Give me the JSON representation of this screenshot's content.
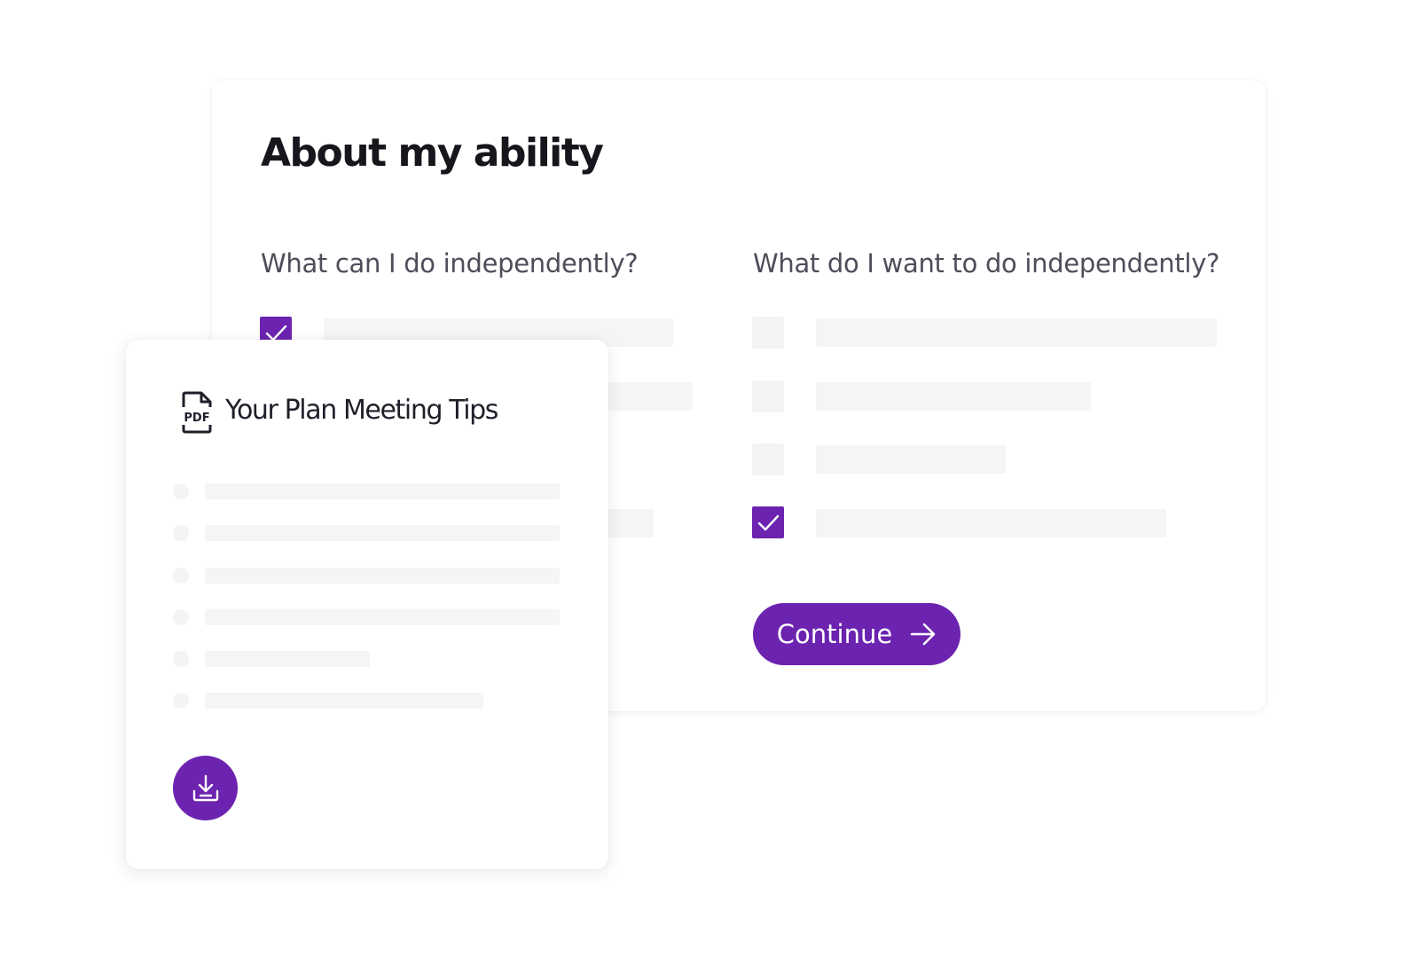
{
  "main_card": {
    "title": "About my ability",
    "left_column": {
      "question": "What can I do independently?",
      "checkboxes_checked": [
        true,
        false,
        false,
        false
      ]
    },
    "right_column": {
      "question": "What do I want to do independently?",
      "checkboxes_checked": [
        false,
        false,
        false,
        true
      ]
    },
    "continue_label": "Continue",
    "continue_icon": "arrow-right-icon"
  },
  "tips_card": {
    "title": "Your Plan Meeting Tips",
    "file_icon": "pdf-file-icon",
    "file_icon_label": "PDF",
    "download_icon": "download-icon"
  },
  "colors": {
    "accent": "#6c23b0",
    "placeholder": "#f5f5f6",
    "heading": "#16161c",
    "question_text": "#4e4d5a"
  }
}
